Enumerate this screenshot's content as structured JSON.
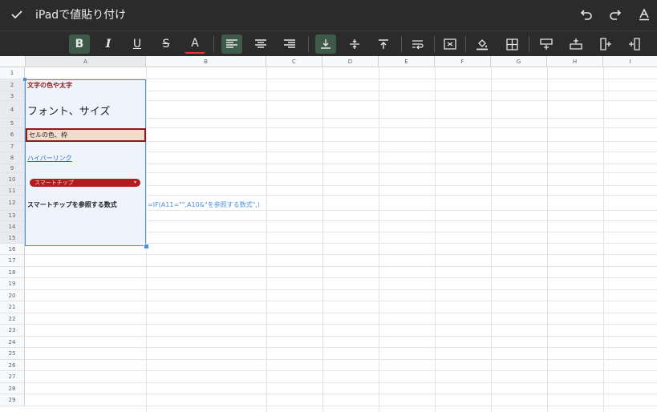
{
  "window": {
    "title": "iPadで値貼り付け",
    "done_icon": "checkmark-icon",
    "actions": [
      "undo-icon",
      "redo-icon",
      "text-format-icon"
    ]
  },
  "toolbar": {
    "bold": "B",
    "italic": "I",
    "underline": "U",
    "strike": "S",
    "text_color": "A",
    "active_color": "#3e5a48",
    "text_color_underline": "#e53935"
  },
  "sheet": {
    "columns": [
      "A",
      "B",
      "C",
      "D",
      "E",
      "F",
      "G",
      "H",
      "I"
    ],
    "rows": [
      "1",
      "2",
      "3",
      "4",
      "5",
      "6",
      "7",
      "8",
      "9",
      "10",
      "11",
      "12",
      "13",
      "14",
      "15",
      "16",
      "17",
      "18",
      "19",
      "20",
      "21",
      "22",
      "23",
      "24",
      "25",
      "26",
      "27",
      "28",
      "29"
    ],
    "cells": {
      "a2": "文字の色や太字",
      "a4": "フォント、サイズ",
      "a6": "セルの色、枠",
      "a8": "ハイパーリンク",
      "a10": "スマートチップ",
      "a12": "スマートチップを参照する数式",
      "b12": "=IF(A11=\"\",A10&\"を参照する数式\",)"
    },
    "colors": {
      "selection": "#4a90d9",
      "red_text": "#8b1a1a",
      "cell_fill": "#f4dccd",
      "cell_border": "#8b1a1a",
      "link": "#3366cc",
      "chip": "#b31c1c",
      "formula": "#4a90d9"
    }
  }
}
